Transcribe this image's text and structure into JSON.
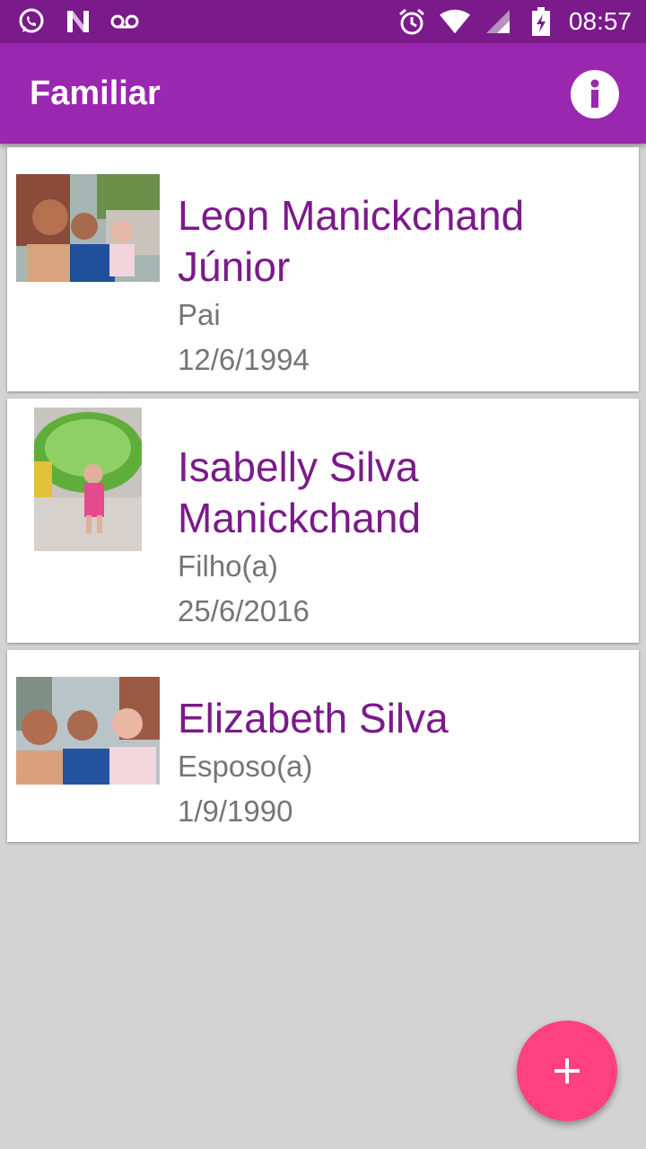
{
  "status_bar": {
    "time": "08:57",
    "left_icons": [
      "whatsapp-icon",
      "n-logo-icon",
      "voicemail-icon"
    ],
    "right_icons": [
      "alarm-icon",
      "wifi-icon",
      "signal-icon",
      "battery-charging-icon"
    ]
  },
  "app_bar": {
    "title": "Familiar",
    "action_icon": "info-icon"
  },
  "members": [
    {
      "name": "Leon Manickchand Júnior",
      "relation": "Pai",
      "birthdate": "12/6/1994"
    },
    {
      "name": "Isabelly Silva Manickchand",
      "relation": "Filho(a)",
      "birthdate": "25/6/2016"
    },
    {
      "name": "Elizabeth Silva",
      "relation": "Esposo(a)",
      "birthdate": "1/9/1990"
    }
  ],
  "fab": {
    "icon": "plus-icon",
    "label": "+"
  },
  "colors": {
    "status_bar": "#7b1a8a",
    "app_bar": "#9a27b0",
    "name_text": "#7b1a8a",
    "secondary_text": "#757575",
    "fab": "#ff4081",
    "background": "#d3d3d3"
  }
}
